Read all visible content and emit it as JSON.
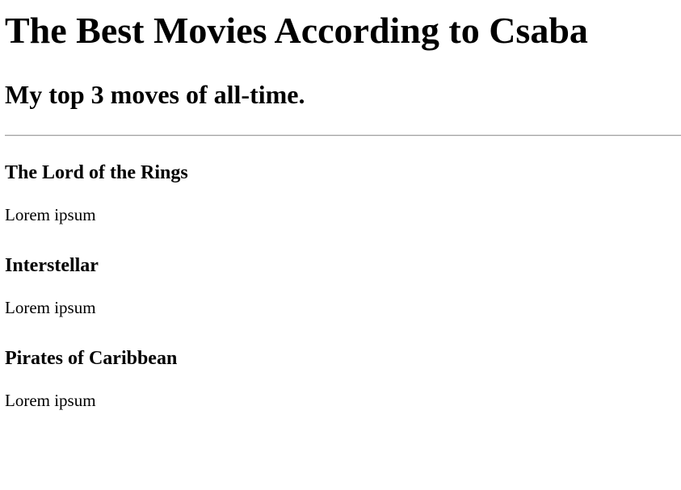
{
  "page": {
    "title": "The Best Movies According to Csaba",
    "subtitle": "My top 3 moves of all-time."
  },
  "movies": [
    {
      "title": "The Lord of the Rings",
      "description": "Lorem ipsum"
    },
    {
      "title": "Interstellar",
      "description": "Lorem ipsum"
    },
    {
      "title": "Pirates of Caribbean",
      "description": "Lorem ipsum"
    }
  ]
}
